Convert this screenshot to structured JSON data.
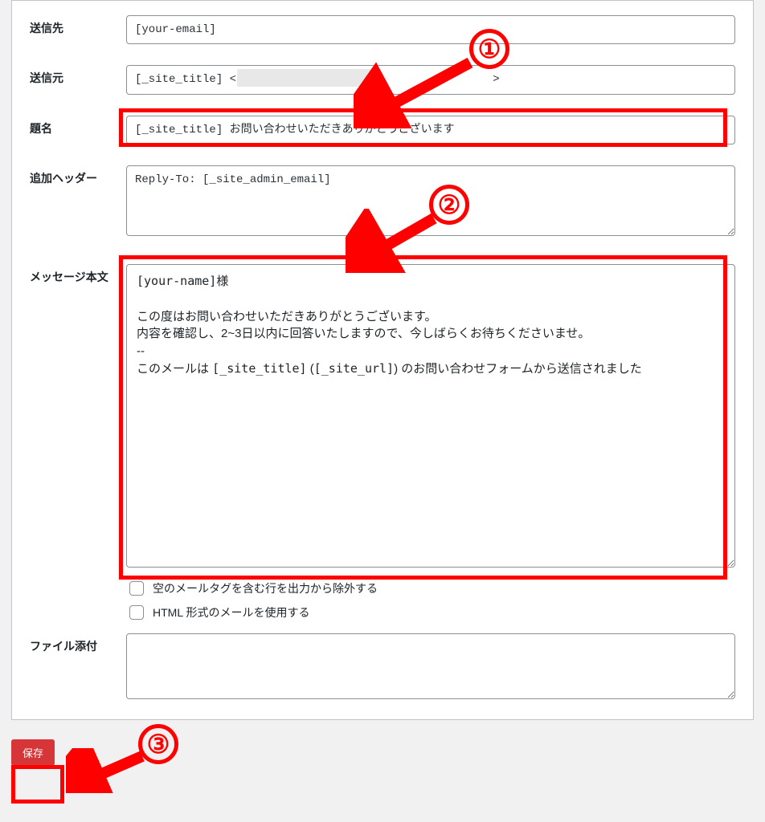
{
  "labels": {
    "to": "送信先",
    "from": "送信元",
    "subject": "題名",
    "additional_headers": "追加ヘッダー",
    "message_body": "メッセージ本文",
    "file_attachment": "ファイル添付"
  },
  "fields": {
    "to": "[your-email]",
    "from_prefix": "[_site_title] <",
    "from_suffix": ">",
    "subject": "[_site_title] お問い合わせいただきありがとうございます",
    "additional_headers": "Reply-To: [_site_admin_email]",
    "body_line1_tag": "[your-name]",
    "body_line1_suffix": "様",
    "body_line3": "この度はお問い合わせいただきありがとうございます。",
    "body_line4": "内容を確認し、2~3日以内に回答いたしますので、今しばらくお待ちくださいませ。",
    "body_line5": "--",
    "body_line6_a": "このメールは ",
    "body_line6_tag1": "[_site_title]",
    "body_line6_b": " (",
    "body_line6_tag2": "[_site_url]",
    "body_line6_c": ") のお問い合わせフォームから送信されました",
    "file_attachment": ""
  },
  "checks": {
    "exclude_empty": "空のメールタグを含む行を出力から除外する",
    "use_html": "HTML 形式のメールを使用する"
  },
  "buttons": {
    "save": "保存"
  },
  "callouts": {
    "one": "①",
    "two": "②",
    "three": "③"
  }
}
